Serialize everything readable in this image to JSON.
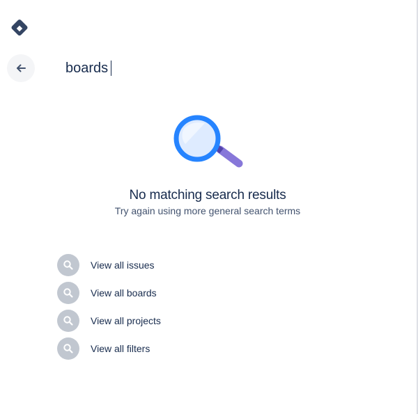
{
  "app": {
    "logo_icon": "jira-diamond-icon",
    "brand_color": "#344563"
  },
  "header": {
    "back_icon": "arrow-left-icon"
  },
  "search": {
    "value": "boards"
  },
  "empty_state": {
    "illustration_icon": "magnifying-glass-icon",
    "title": "No matching search results",
    "subtitle": "Try again using more general search terms"
  },
  "suggestions": [
    {
      "label": "View all issues",
      "icon": "search-icon"
    },
    {
      "label": "View all boards",
      "icon": "search-icon"
    },
    {
      "label": "View all projects",
      "icon": "search-icon"
    },
    {
      "label": "View all filters",
      "icon": "search-icon"
    }
  ],
  "colors": {
    "text_primary": "#172b4d",
    "text_secondary": "#42526e",
    "icon_circle": "#c1c7d0",
    "lens_ring": "#2684ff",
    "handle": "#8777d9"
  }
}
